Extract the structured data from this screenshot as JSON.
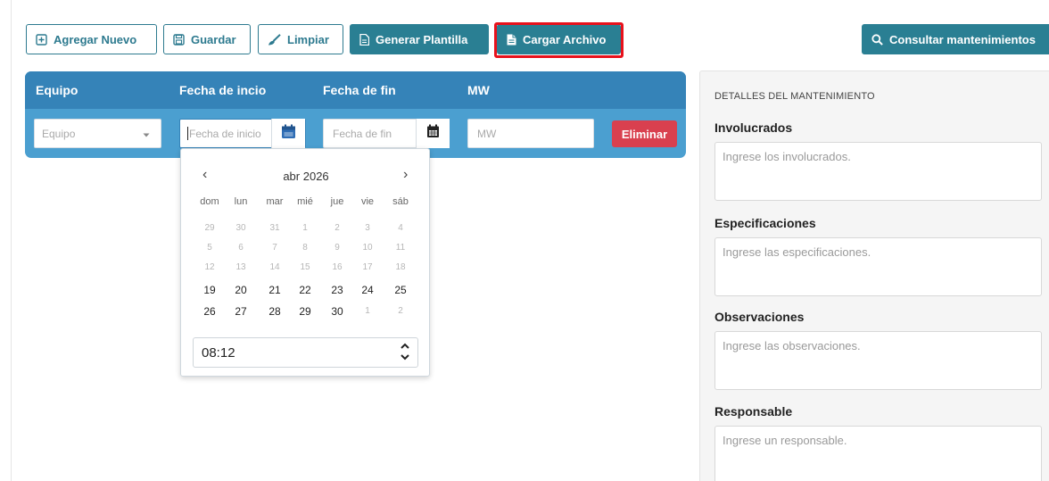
{
  "toolbar": {
    "add_new": "Agregar Nuevo",
    "save": "Guardar",
    "clear": "Limpiar",
    "generate_template": "Generar Plantilla",
    "upload_file": "Cargar Archivo",
    "query_maintenance": "Consultar mantenimientos"
  },
  "table": {
    "headers": [
      "Equipo",
      "Fecha de incio",
      "Fecha de fin",
      "MW"
    ],
    "row": {
      "equipo_placeholder": "Equipo",
      "start_placeholder": "Fecha de inicio",
      "end_placeholder": "Fecha de fin",
      "mw_placeholder": "MW",
      "delete": "Eliminar"
    }
  },
  "datepicker": {
    "month_label": "abr 2026",
    "prev": "‹",
    "next": "›",
    "weekdays": [
      "dom",
      "lun",
      "mar",
      "mié",
      "jue",
      "vie",
      "sáb"
    ],
    "weeks": [
      [
        "29",
        "30",
        "31",
        "1",
        "2",
        "3",
        "4"
      ],
      [
        "5",
        "6",
        "7",
        "8",
        "9",
        "10",
        "11"
      ],
      [
        "12",
        "13",
        "14",
        "15",
        "16",
        "17",
        "18"
      ],
      [
        "19",
        "20",
        "21",
        "22",
        "23",
        "24",
        "25"
      ],
      [
        "26",
        "27",
        "28",
        "29",
        "30",
        "1",
        "2"
      ]
    ],
    "time": "08:12"
  },
  "details": {
    "title": "DETALLES DEL MANTENIMIENTO",
    "involucrados_label": "Involucrados",
    "involucrados_placeholder": "Ingrese los involucrados.",
    "especificaciones_label": "Especificaciones",
    "especificaciones_placeholder": "Ingrese las especificaciones.",
    "observaciones_label": "Observaciones",
    "observaciones_placeholder": "Ingrese las observaciones.",
    "responsable_label": "Responsable",
    "responsable_placeholder": "Ingrese un responsable."
  },
  "colors": {
    "teal": "#2a7f93",
    "header_blue": "#3583b8",
    "row_blue": "#4b9fd0",
    "danger": "#d9404f",
    "highlight_red": "#e8111b"
  }
}
